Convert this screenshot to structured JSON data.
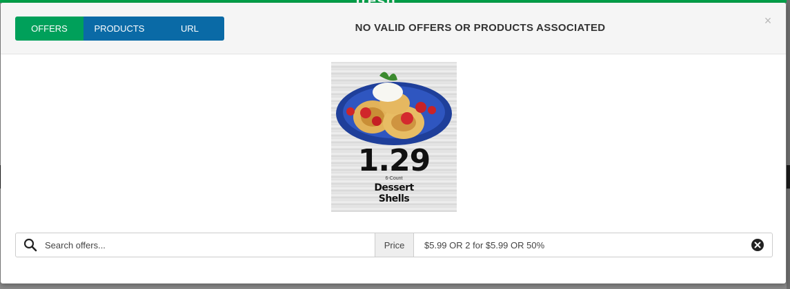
{
  "background": {
    "logo_text": "fresh"
  },
  "modal": {
    "tabs": [
      {
        "label": "OFFERS",
        "active": true,
        "color": "#00a05a"
      },
      {
        "label": "PRODUCTS",
        "active": false,
        "color": "#0a6aa6"
      },
      {
        "label": "URL",
        "active": false,
        "color": "#0a6aa6"
      }
    ],
    "title": "NO VALID OFFERS OR PRODUCTS ASSOCIATED",
    "close_symbol": "×"
  },
  "product_image": {
    "price": "1.29",
    "count": "6-Count",
    "description_line1": "Dessert",
    "description_line2": "Shells"
  },
  "search": {
    "placeholder": "Search offers...",
    "value": "",
    "price_label": "Price",
    "price_value": "$5.99 OR 2 for $5.99 OR 50%",
    "search_icon": "search-icon",
    "clear_icon": "clear-circle-icon"
  },
  "colors": {
    "accent_green": "#00a05a",
    "accent_blue": "#0a6aa6"
  }
}
